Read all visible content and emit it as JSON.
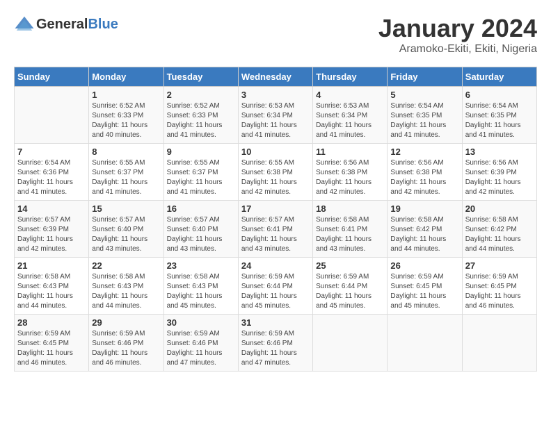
{
  "header": {
    "logo_general": "General",
    "logo_blue": "Blue",
    "month_year": "January 2024",
    "location": "Aramoko-Ekiti, Ekiti, Nigeria"
  },
  "days_of_week": [
    "Sunday",
    "Monday",
    "Tuesday",
    "Wednesday",
    "Thursday",
    "Friday",
    "Saturday"
  ],
  "weeks": [
    [
      {
        "day": "",
        "sunrise": "",
        "sunset": "",
        "daylight": ""
      },
      {
        "day": "1",
        "sunrise": "Sunrise: 6:52 AM",
        "sunset": "Sunset: 6:33 PM",
        "daylight": "Daylight: 11 hours and 40 minutes."
      },
      {
        "day": "2",
        "sunrise": "Sunrise: 6:52 AM",
        "sunset": "Sunset: 6:33 PM",
        "daylight": "Daylight: 11 hours and 41 minutes."
      },
      {
        "day": "3",
        "sunrise": "Sunrise: 6:53 AM",
        "sunset": "Sunset: 6:34 PM",
        "daylight": "Daylight: 11 hours and 41 minutes."
      },
      {
        "day": "4",
        "sunrise": "Sunrise: 6:53 AM",
        "sunset": "Sunset: 6:34 PM",
        "daylight": "Daylight: 11 hours and 41 minutes."
      },
      {
        "day": "5",
        "sunrise": "Sunrise: 6:54 AM",
        "sunset": "Sunset: 6:35 PM",
        "daylight": "Daylight: 11 hours and 41 minutes."
      },
      {
        "day": "6",
        "sunrise": "Sunrise: 6:54 AM",
        "sunset": "Sunset: 6:35 PM",
        "daylight": "Daylight: 11 hours and 41 minutes."
      }
    ],
    [
      {
        "day": "7",
        "sunrise": "Sunrise: 6:54 AM",
        "sunset": "Sunset: 6:36 PM",
        "daylight": "Daylight: 11 hours and 41 minutes."
      },
      {
        "day": "8",
        "sunrise": "Sunrise: 6:55 AM",
        "sunset": "Sunset: 6:37 PM",
        "daylight": "Daylight: 11 hours and 41 minutes."
      },
      {
        "day": "9",
        "sunrise": "Sunrise: 6:55 AM",
        "sunset": "Sunset: 6:37 PM",
        "daylight": "Daylight: 11 hours and 41 minutes."
      },
      {
        "day": "10",
        "sunrise": "Sunrise: 6:55 AM",
        "sunset": "Sunset: 6:38 PM",
        "daylight": "Daylight: 11 hours and 42 minutes."
      },
      {
        "day": "11",
        "sunrise": "Sunrise: 6:56 AM",
        "sunset": "Sunset: 6:38 PM",
        "daylight": "Daylight: 11 hours and 42 minutes."
      },
      {
        "day": "12",
        "sunrise": "Sunrise: 6:56 AM",
        "sunset": "Sunset: 6:38 PM",
        "daylight": "Daylight: 11 hours and 42 minutes."
      },
      {
        "day": "13",
        "sunrise": "Sunrise: 6:56 AM",
        "sunset": "Sunset: 6:39 PM",
        "daylight": "Daylight: 11 hours and 42 minutes."
      }
    ],
    [
      {
        "day": "14",
        "sunrise": "Sunrise: 6:57 AM",
        "sunset": "Sunset: 6:39 PM",
        "daylight": "Daylight: 11 hours and 42 minutes."
      },
      {
        "day": "15",
        "sunrise": "Sunrise: 6:57 AM",
        "sunset": "Sunset: 6:40 PM",
        "daylight": "Daylight: 11 hours and 43 minutes."
      },
      {
        "day": "16",
        "sunrise": "Sunrise: 6:57 AM",
        "sunset": "Sunset: 6:40 PM",
        "daylight": "Daylight: 11 hours and 43 minutes."
      },
      {
        "day": "17",
        "sunrise": "Sunrise: 6:57 AM",
        "sunset": "Sunset: 6:41 PM",
        "daylight": "Daylight: 11 hours and 43 minutes."
      },
      {
        "day": "18",
        "sunrise": "Sunrise: 6:58 AM",
        "sunset": "Sunset: 6:41 PM",
        "daylight": "Daylight: 11 hours and 43 minutes."
      },
      {
        "day": "19",
        "sunrise": "Sunrise: 6:58 AM",
        "sunset": "Sunset: 6:42 PM",
        "daylight": "Daylight: 11 hours and 44 minutes."
      },
      {
        "day": "20",
        "sunrise": "Sunrise: 6:58 AM",
        "sunset": "Sunset: 6:42 PM",
        "daylight": "Daylight: 11 hours and 44 minutes."
      }
    ],
    [
      {
        "day": "21",
        "sunrise": "Sunrise: 6:58 AM",
        "sunset": "Sunset: 6:43 PM",
        "daylight": "Daylight: 11 hours and 44 minutes."
      },
      {
        "day": "22",
        "sunrise": "Sunrise: 6:58 AM",
        "sunset": "Sunset: 6:43 PM",
        "daylight": "Daylight: 11 hours and 44 minutes."
      },
      {
        "day": "23",
        "sunrise": "Sunrise: 6:58 AM",
        "sunset": "Sunset: 6:43 PM",
        "daylight": "Daylight: 11 hours and 45 minutes."
      },
      {
        "day": "24",
        "sunrise": "Sunrise: 6:59 AM",
        "sunset": "Sunset: 6:44 PM",
        "daylight": "Daylight: 11 hours and 45 minutes."
      },
      {
        "day": "25",
        "sunrise": "Sunrise: 6:59 AM",
        "sunset": "Sunset: 6:44 PM",
        "daylight": "Daylight: 11 hours and 45 minutes."
      },
      {
        "day": "26",
        "sunrise": "Sunrise: 6:59 AM",
        "sunset": "Sunset: 6:45 PM",
        "daylight": "Daylight: 11 hours and 45 minutes."
      },
      {
        "day": "27",
        "sunrise": "Sunrise: 6:59 AM",
        "sunset": "Sunset: 6:45 PM",
        "daylight": "Daylight: 11 hours and 46 minutes."
      }
    ],
    [
      {
        "day": "28",
        "sunrise": "Sunrise: 6:59 AM",
        "sunset": "Sunset: 6:45 PM",
        "daylight": "Daylight: 11 hours and 46 minutes."
      },
      {
        "day": "29",
        "sunrise": "Sunrise: 6:59 AM",
        "sunset": "Sunset: 6:46 PM",
        "daylight": "Daylight: 11 hours and 46 minutes."
      },
      {
        "day": "30",
        "sunrise": "Sunrise: 6:59 AM",
        "sunset": "Sunset: 6:46 PM",
        "daylight": "Daylight: 11 hours and 47 minutes."
      },
      {
        "day": "31",
        "sunrise": "Sunrise: 6:59 AM",
        "sunset": "Sunset: 6:46 PM",
        "daylight": "Daylight: 11 hours and 47 minutes."
      },
      {
        "day": "",
        "sunrise": "",
        "sunset": "",
        "daylight": ""
      },
      {
        "day": "",
        "sunrise": "",
        "sunset": "",
        "daylight": ""
      },
      {
        "day": "",
        "sunrise": "",
        "sunset": "",
        "daylight": ""
      }
    ]
  ]
}
